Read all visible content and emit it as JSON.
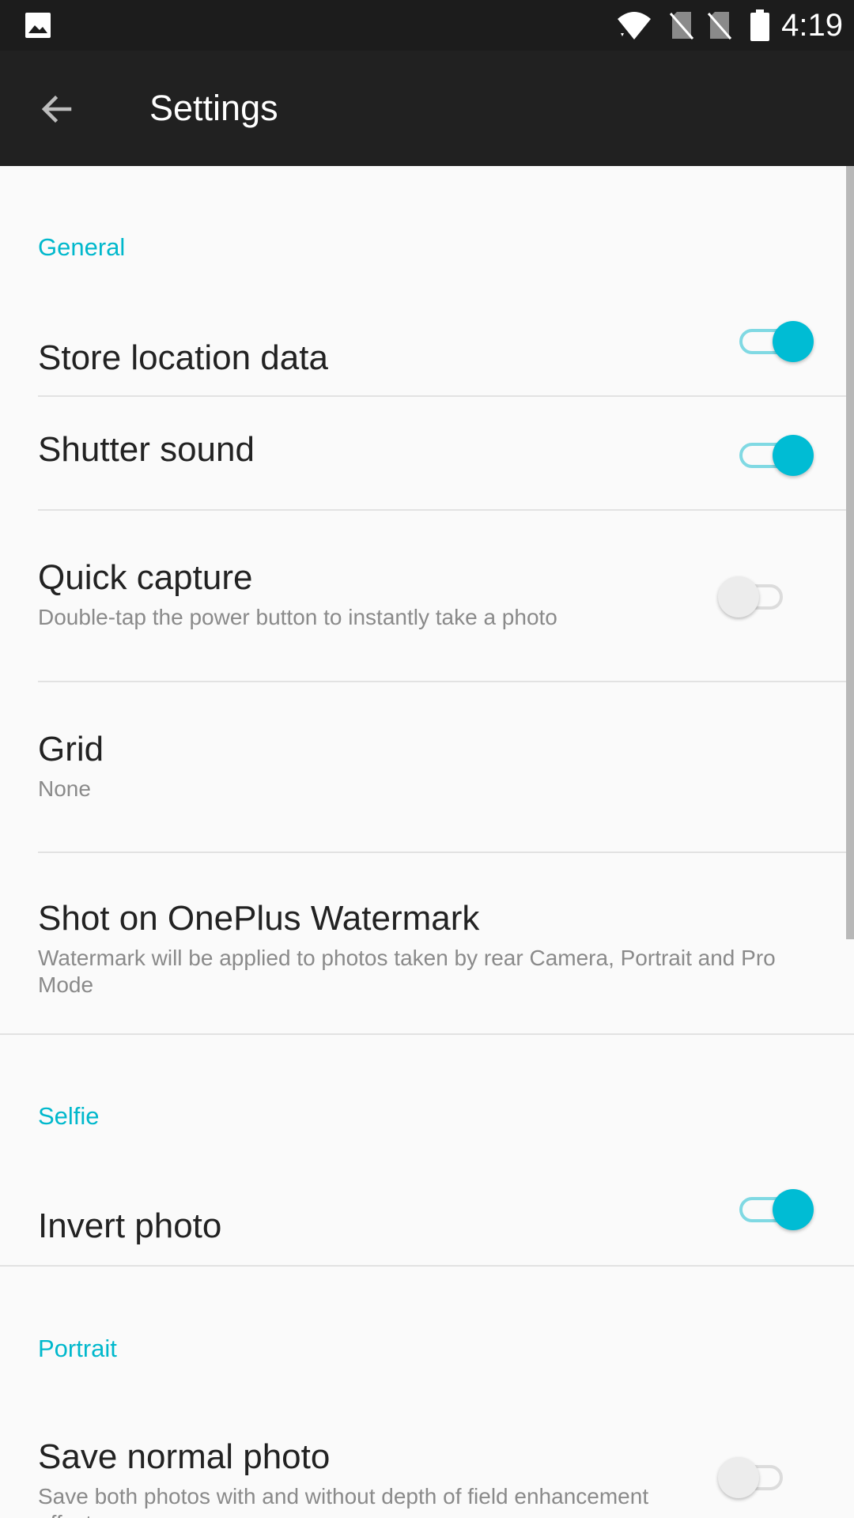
{
  "status_bar": {
    "time": "4:19",
    "icons": [
      "image-icon",
      "wifi-icon",
      "no-sim-icon",
      "no-sim-icon",
      "battery-icon"
    ]
  },
  "app_bar": {
    "title": "Settings",
    "back_icon": "arrow-back-icon"
  },
  "colors": {
    "accent": "#00bcd4",
    "status_bar": "#1c1c1c",
    "app_bar": "#212121",
    "background": "#fafafa"
  },
  "sections": {
    "general": {
      "header": "General",
      "store_location": {
        "title": "Store location data",
        "enabled": true
      },
      "shutter_sound": {
        "title": "Shutter sound",
        "enabled": true
      },
      "quick_capture": {
        "title": "Quick capture",
        "subtitle": "Double-tap the power button to instantly take a photo",
        "enabled": false
      },
      "grid": {
        "title": "Grid",
        "value": "None"
      },
      "watermark": {
        "title": "Shot on OnePlus Watermark",
        "subtitle": "Watermark will be applied to photos taken by rear Camera, Portrait and Pro Mode"
      }
    },
    "selfie": {
      "header": "Selfie",
      "invert_photo": {
        "title": "Invert photo",
        "enabled": true
      }
    },
    "portrait": {
      "header": "Portrait",
      "save_normal_photo": {
        "title": "Save normal photo",
        "subtitle": "Save both photos with and without depth of field enhancement effects",
        "enabled": false
      }
    }
  }
}
